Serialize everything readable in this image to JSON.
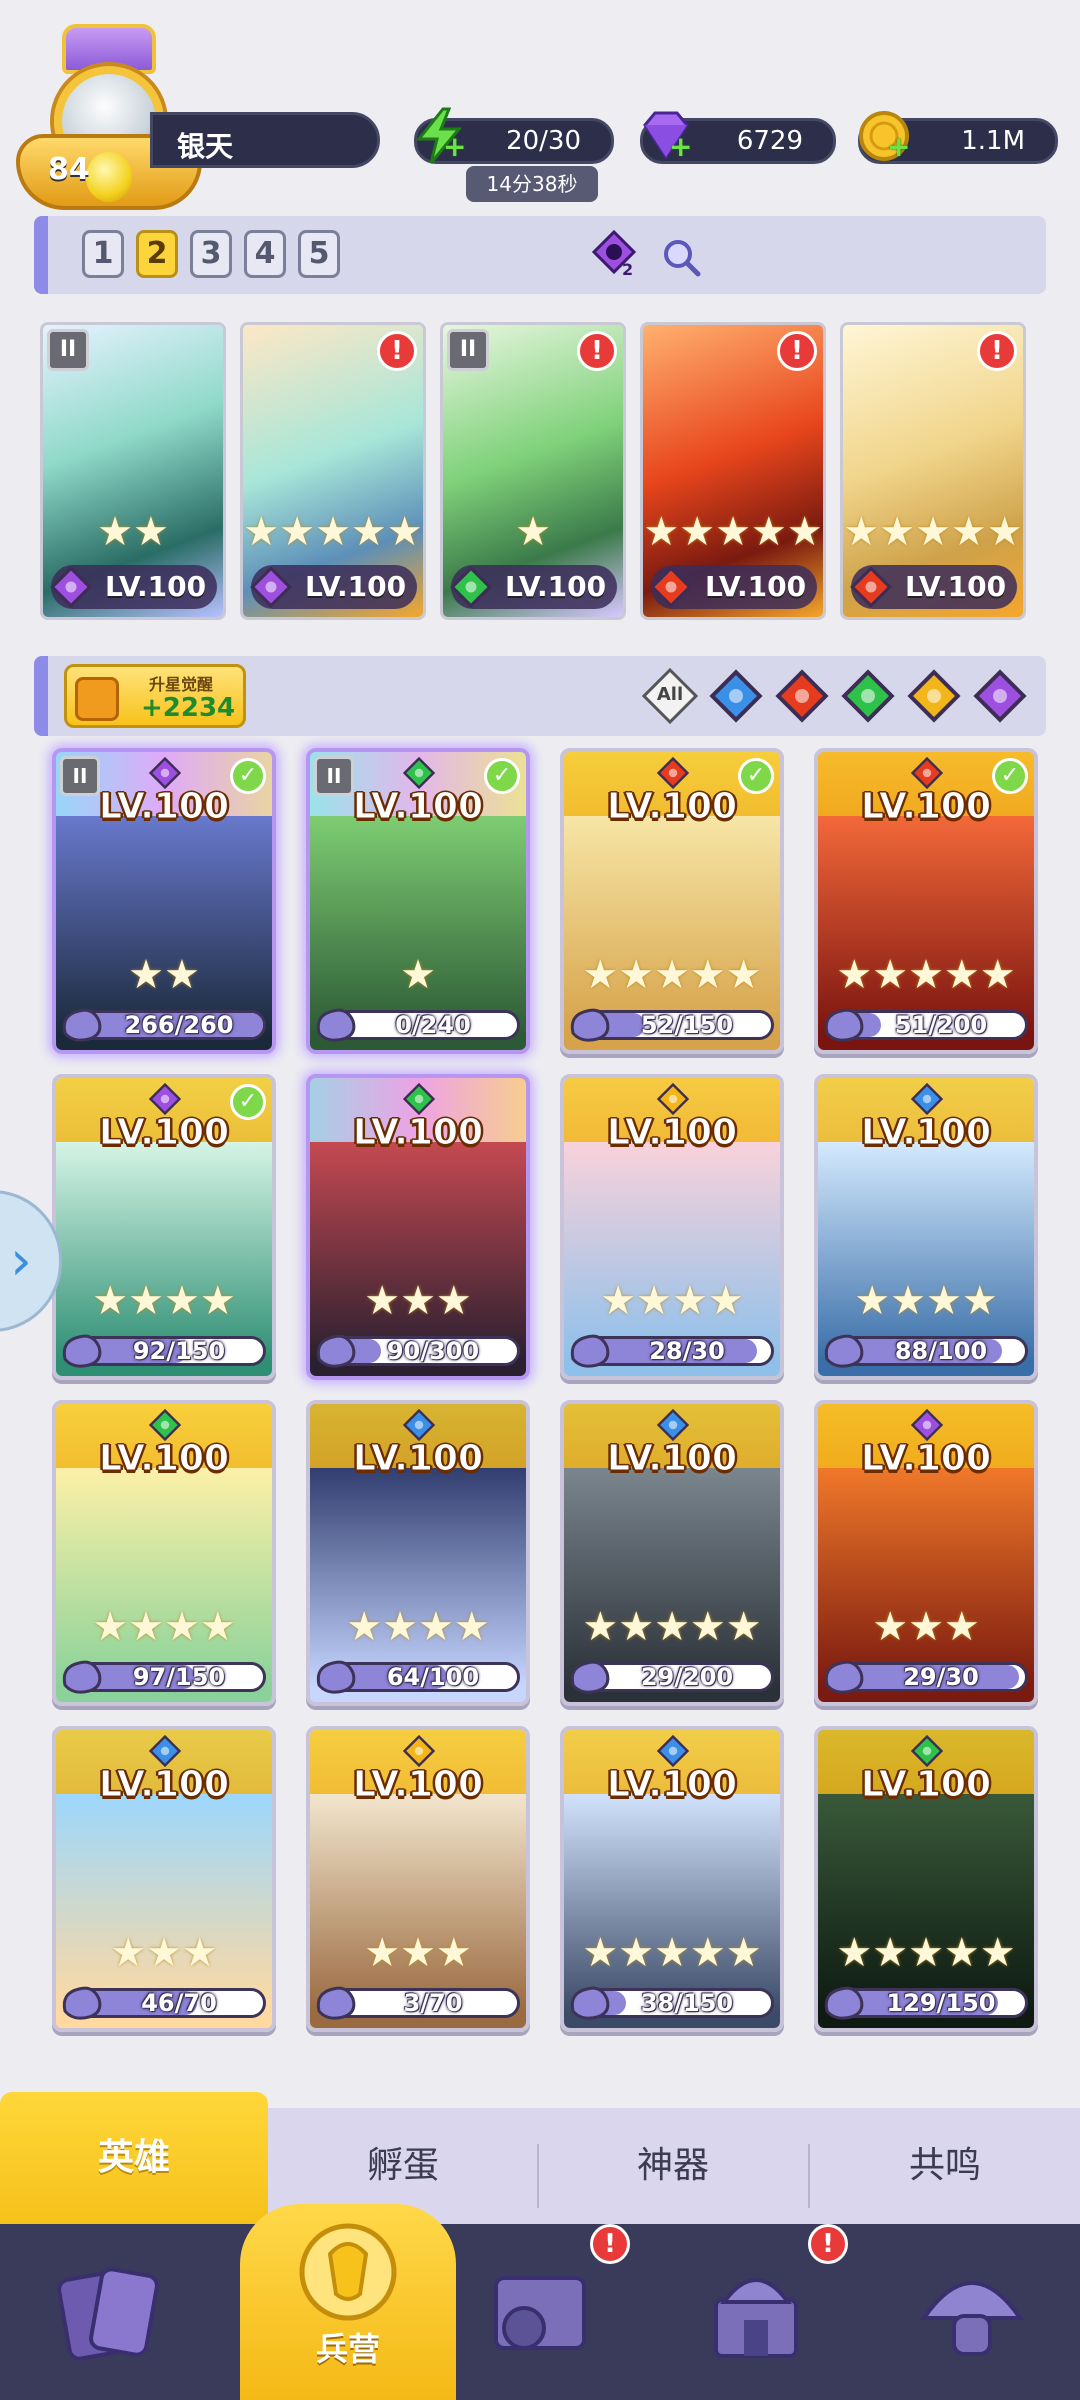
{
  "header": {
    "player_level": "84",
    "player_name": "银天",
    "energy": "20/30",
    "energy_timer": "14分38秒",
    "gems": "6729",
    "coins": "1.1M"
  },
  "team": {
    "numbers": [
      "1",
      "2",
      "3",
      "4",
      "5"
    ],
    "active_index": 1,
    "element_icon_count": "2",
    "cards": [
      {
        "level": "LV.100",
        "stars": "★★",
        "element": "dark",
        "badge": "II",
        "alert": false
      },
      {
        "level": "LV.100",
        "stars": "★★★★★",
        "element": "dark",
        "badge": "",
        "alert": true
      },
      {
        "level": "LV.100",
        "stars": "★",
        "element": "nature",
        "badge": "II",
        "alert": true
      },
      {
        "level": "LV.100",
        "stars": "★★★★★",
        "element": "fire",
        "badge": "",
        "alert": true
      },
      {
        "level": "LV.100",
        "stars": "★★★★★",
        "element": "fire",
        "badge": "",
        "alert": true
      }
    ]
  },
  "filter": {
    "awaken_label": "升星觉醒",
    "awaken_count": "+2234",
    "all_label": "All",
    "elements": [
      "water",
      "fire",
      "nature",
      "light",
      "dark"
    ]
  },
  "heroes": [
    {
      "level": "LV.100",
      "element": "dark",
      "fragments": "266/260",
      "fill": 1.0,
      "stars": "★★",
      "check": true,
      "badge": "II",
      "selected": true,
      "theme": "dark"
    },
    {
      "level": "LV.100",
      "element": "nature",
      "fragments": "0/240",
      "fill": 0.0,
      "stars": "★",
      "check": true,
      "badge": "II",
      "selected": true,
      "theme": "nature"
    },
    {
      "level": "LV.100",
      "element": "fire",
      "fragments": "52/150",
      "fill": 0.35,
      "stars": "★★★★★",
      "check": true,
      "badge": "",
      "selected": false,
      "theme": "gold"
    },
    {
      "level": "LV.100",
      "element": "fire",
      "fragments": "51/200",
      "fill": 0.26,
      "stars": "★★★★★",
      "check": true,
      "badge": "",
      "selected": false,
      "theme": "fire"
    },
    {
      "level": "LV.100",
      "element": "dark",
      "fragments": "92/150",
      "fill": 0.61,
      "stars": "★★★★",
      "check": true,
      "badge": "",
      "selected": false,
      "theme": "teal"
    },
    {
      "level": "LV.100",
      "element": "nature",
      "fragments": "90/300",
      "fill": 0.3,
      "stars": "★★★",
      "check": false,
      "badge": "",
      "selected": true,
      "theme": "wolf"
    },
    {
      "level": "LV.100",
      "element": "light",
      "fragments": "28/30",
      "fill": 0.93,
      "stars": "★★★★",
      "check": false,
      "badge": "",
      "selected": false,
      "theme": "pink"
    },
    {
      "level": "LV.100",
      "element": "water",
      "fragments": "88/100",
      "fill": 0.88,
      "stars": "★★★★",
      "check": false,
      "badge": "",
      "selected": false,
      "theme": "ice"
    },
    {
      "level": "LV.100",
      "element": "nature",
      "fragments": "97/150",
      "fill": 0.65,
      "stars": "★★★★",
      "check": false,
      "badge": "",
      "selected": false,
      "theme": "blonde"
    },
    {
      "level": "LV.100",
      "element": "water",
      "fragments": "64/100",
      "fill": 0.64,
      "stars": "★★★★",
      "check": false,
      "badge": "",
      "selected": false,
      "theme": "witch"
    },
    {
      "level": "LV.100",
      "element": "water",
      "fragments": "29/200",
      "fill": 0.15,
      "stars": "★★★★★",
      "check": false,
      "badge": "",
      "selected": false,
      "theme": "grey"
    },
    {
      "level": "LV.100",
      "element": "dark",
      "fragments": "29/30",
      "fill": 0.97,
      "stars": "★★★",
      "check": false,
      "badge": "",
      "selected": false,
      "theme": "monkey"
    },
    {
      "level": "LV.100",
      "element": "water",
      "fragments": "46/70",
      "fill": 0.66,
      "stars": "★★★",
      "check": false,
      "badge": "",
      "selected": false,
      "theme": "sky"
    },
    {
      "level": "LV.100",
      "element": "light",
      "fragments": "3/70",
      "fill": 0.04,
      "stars": "★★★",
      "check": false,
      "badge": "",
      "selected": false,
      "theme": "cowboy"
    },
    {
      "level": "LV.100",
      "element": "water",
      "fragments": "38/150",
      "fill": 0.25,
      "stars": "★★★★★",
      "check": false,
      "badge": "",
      "selected": false,
      "theme": "frost"
    },
    {
      "level": "LV.100",
      "element": "nature",
      "fragments": "129/150",
      "fill": 0.86,
      "stars": "★★★★★",
      "check": false,
      "badge": "",
      "selected": false,
      "theme": "shadow"
    }
  ],
  "sub_tabs": [
    "英雄",
    "孵蛋",
    "神器",
    "共鸣"
  ],
  "bottom_nav": {
    "barracks_label": "兵营",
    "items": [
      "cards-icon",
      "barracks-icon",
      "map-icon",
      "temple-icon",
      "mushroom-icon"
    ],
    "alerts": [
      false,
      false,
      true,
      true,
      false
    ]
  },
  "colors": {
    "water": "#3a8fe6",
    "fire": "#e63b1e",
    "nature": "#2ec24a",
    "light": "#f2b51a",
    "dark": "#9d4fe0"
  }
}
